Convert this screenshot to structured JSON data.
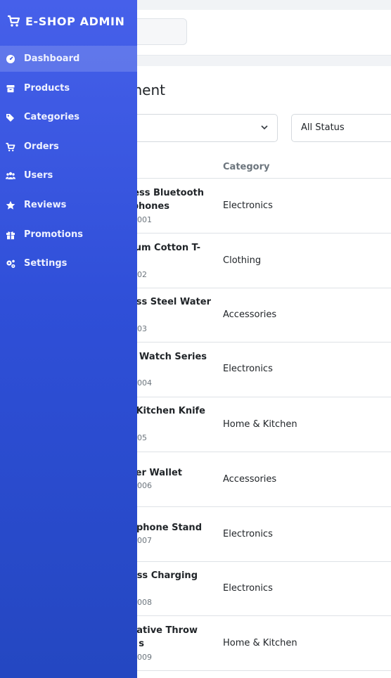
{
  "app": {
    "brand": "E-SHOP ADMIN"
  },
  "sidebar": {
    "items": [
      {
        "label": "Dashboard",
        "icon": "dashboard-icon",
        "active": true
      },
      {
        "label": "Products",
        "icon": "box-icon",
        "active": false
      },
      {
        "label": "Categories",
        "icon": "tags-icon",
        "active": false
      },
      {
        "label": "Orders",
        "icon": "cart-icon",
        "active": false
      },
      {
        "label": "Users",
        "icon": "users-icon",
        "active": false
      },
      {
        "label": "Reviews",
        "icon": "star-icon",
        "active": false
      },
      {
        "label": "Promotions",
        "icon": "gift-icon",
        "active": false
      },
      {
        "label": "Settings",
        "icon": "cogs-icon",
        "active": false
      }
    ]
  },
  "main": {
    "title_visible": "ment",
    "filters": {
      "category_value": "",
      "status_value": "All Status"
    },
    "table": {
      "headers": {
        "category": "Category"
      },
      "rows": [
        {
          "name_lines": [
            "ess Bluetooth",
            "phones"
          ],
          "sku": "001",
          "category": "Electronics"
        },
        {
          "name_lines": [
            "ium Cotton T-",
            ""
          ],
          "sku": "02",
          "category": "Clothing"
        },
        {
          "name_lines": [
            "ess Steel Water",
            ""
          ],
          "sku": "03",
          "category": "Accessories"
        },
        {
          "name_lines": [
            "Watch Series",
            ""
          ],
          "sku": "004",
          "category": "Electronics"
        },
        {
          "name_lines": "Kitchen Knife",
          "sku": "05",
          "category": "Home & Kitchen"
        },
        {
          "name_lines": "er Wallet",
          "sku": "006",
          "category": "Accessories"
        },
        {
          "name_lines": "tphone Stand",
          "sku": "007",
          "category": "Electronics"
        },
        {
          "name_lines": "ess Charging",
          "sku": "008",
          "category": "Electronics"
        },
        {
          "name_lines": [
            "ative Throw",
            "s"
          ],
          "sku": "009",
          "category": "Home & Kitchen"
        }
      ]
    }
  },
  "colors": {
    "sidebar_top": "#4660ea",
    "sidebar_bottom": "#2447c1",
    "text_muted": "#6c757d"
  }
}
